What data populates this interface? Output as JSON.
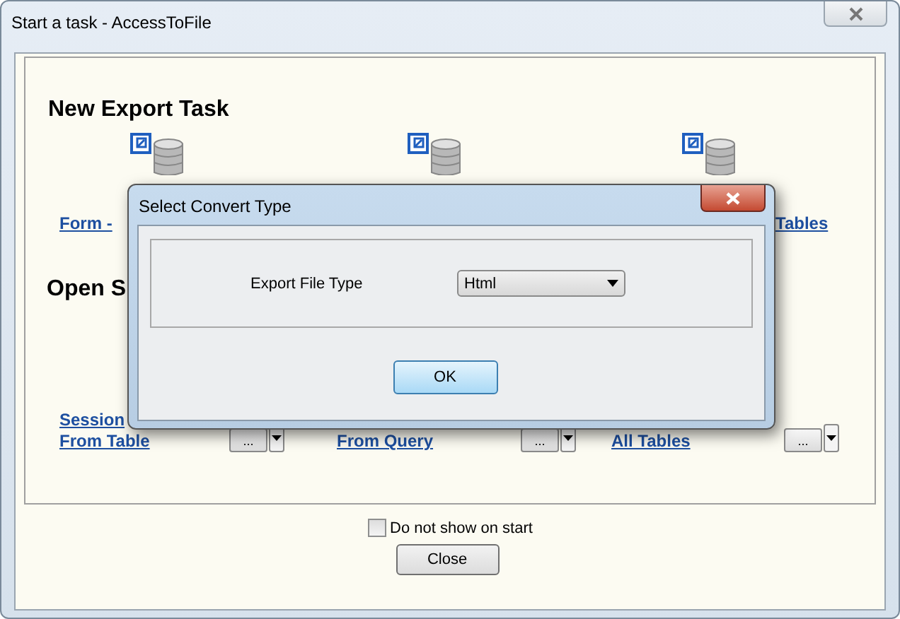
{
  "window": {
    "title": "Start a task - AccessToFile"
  },
  "export_section": {
    "heading": "New Export Task",
    "links": [
      "Form -",
      "Tables"
    ]
  },
  "open_section": {
    "heading": "Open S",
    "items": [
      {
        "lines": [
          "Session",
          "From Table"
        ],
        "browse": "..."
      },
      {
        "lines": [
          "From Query"
        ],
        "browse": "..."
      },
      {
        "lines": [
          "All Tables"
        ],
        "browse": "..."
      }
    ]
  },
  "show_on_start": {
    "label": "Do not show on start",
    "checked": false
  },
  "close_button": "Close",
  "dialog": {
    "title": "Select Convert Type",
    "field_label": "Export File Type",
    "value": "Html",
    "ok": "OK"
  }
}
